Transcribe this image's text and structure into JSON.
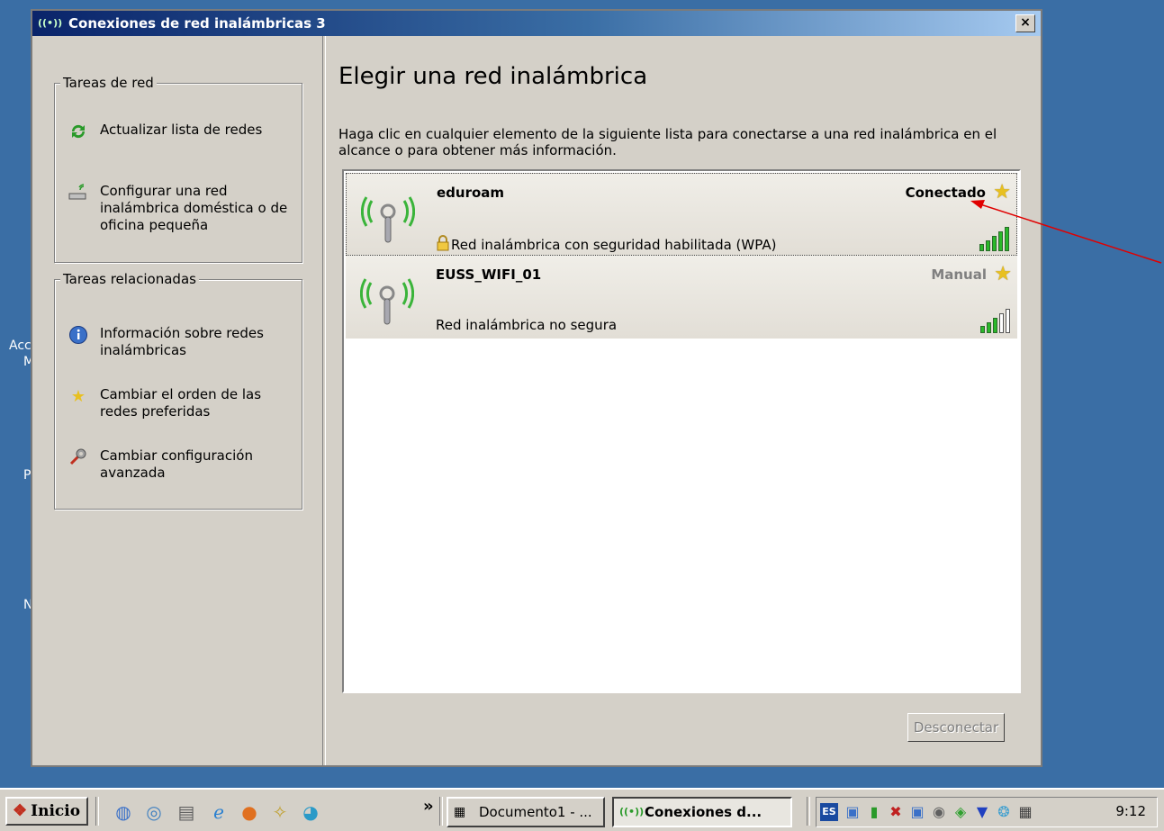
{
  "desktop": {
    "labels": [
      "Acc",
      "M",
      "P",
      "N"
    ]
  },
  "window": {
    "title": "Conexiones de red inalámbricas 3",
    "close_label": "×"
  },
  "left_pane": {
    "network_tasks": {
      "label": "Tareas de red",
      "items": [
        {
          "label": "Actualizar lista de redes",
          "icon": "refresh-icon"
        },
        {
          "label": "Configurar una red inalámbrica doméstica o de oficina pequeña",
          "icon": "wireless-setup-icon"
        }
      ]
    },
    "related_tasks": {
      "label": "Tareas relacionadas",
      "items": [
        {
          "label": "Información sobre redes inalámbricas",
          "icon": "info-icon"
        },
        {
          "label": "Cambiar el orden de las redes preferidas",
          "icon": "star-icon"
        },
        {
          "label": "Cambiar configuración avanzada",
          "icon": "settings-icon"
        }
      ]
    }
  },
  "main": {
    "heading": "Elegir una red inalámbrica",
    "description": "Haga clic en cualquier elemento de la siguiente lista para conectarse a una red inalámbrica en el alcance o para obtener más información.",
    "networks": [
      {
        "name": "eduroam",
        "status": "Conectado",
        "security": "Red inalámbrica con seguridad habilitada (WPA)",
        "signal_bars": 5,
        "secured": true
      },
      {
        "name": "EUSS_WIFI_01",
        "status": "Manual",
        "security": "Red inalámbrica no segura",
        "signal_bars": 3,
        "secured": false
      }
    ],
    "disconnect_label": "Desconectar"
  },
  "annotation": {
    "color": "#e00000"
  },
  "taskbar": {
    "start_label": "Inicio",
    "chevron": "»",
    "buttons": [
      {
        "label": "Documento1 - ...",
        "icon": "word-icon"
      },
      {
        "label": "Conexiones d...",
        "icon": "wireless-icon"
      }
    ],
    "tray_lang": "ES",
    "clock": "9:12"
  }
}
